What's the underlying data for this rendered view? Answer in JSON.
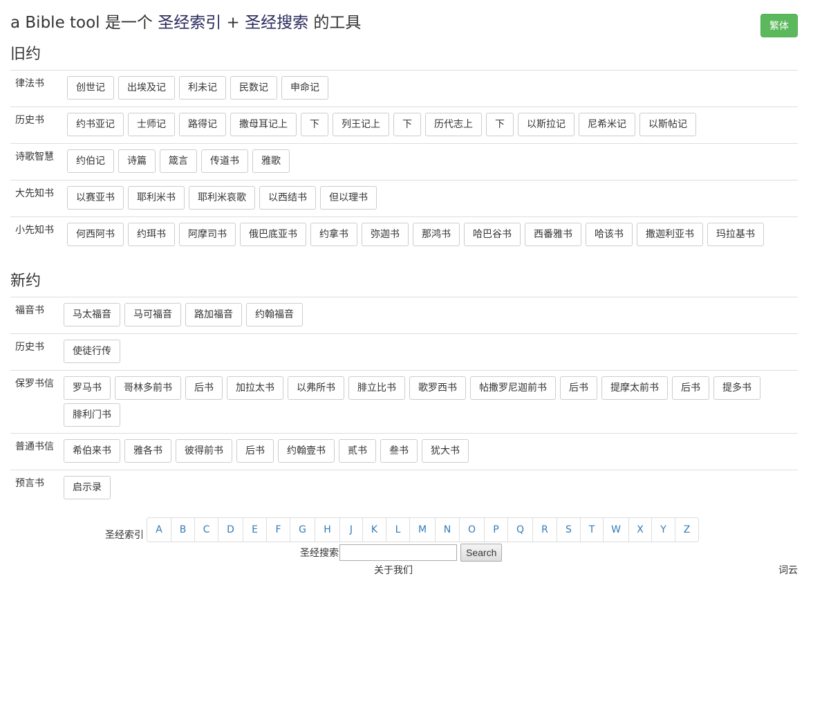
{
  "header": {
    "title_prefix": "a Bible tool",
    "title_middle1": " 是一个 ",
    "title_link1": "圣经索引",
    "title_plus": " + ",
    "title_link2": "圣经搜索",
    "title_suffix": " 的工具",
    "toggle_label": "繁体"
  },
  "old_testament": {
    "title": "旧约",
    "categories": [
      {
        "name": "律法书",
        "books": [
          "创世记",
          "出埃及记",
          "利未记",
          "民数记",
          "申命记"
        ]
      },
      {
        "name": "历史书",
        "books": [
          "约书亚记",
          "士师记",
          "路得记",
          "撒母耳记上",
          "下",
          "列王记上",
          "下",
          "历代志上",
          "下",
          "以斯拉记",
          "尼希米记",
          "以斯帖记"
        ]
      },
      {
        "name": "诗歌智慧",
        "books": [
          "约伯记",
          "诗篇",
          "箴言",
          "传道书",
          "雅歌"
        ]
      },
      {
        "name": "大先知书",
        "books": [
          "以赛亚书",
          "耶利米书",
          "耶利米哀歌",
          "以西结书",
          "但以理书"
        ]
      },
      {
        "name": "小先知书",
        "books": [
          "何西阿书",
          "约珥书",
          "阿摩司书",
          "俄巴底亚书",
          "约拿书",
          "弥迦书",
          "那鸿书",
          "哈巴谷书",
          "西番雅书",
          "哈该书",
          "撒迦利亚书",
          "玛拉基书"
        ]
      }
    ]
  },
  "new_testament": {
    "title": "新约",
    "categories": [
      {
        "name": "福音书",
        "books": [
          "马太福音",
          "马可福音",
          "路加福音",
          "约翰福音"
        ]
      },
      {
        "name": "历史书",
        "books": [
          "使徒行传"
        ]
      },
      {
        "name": "保罗书信",
        "books": [
          "罗马书",
          "哥林多前书",
          "后书",
          "加拉太书",
          "以弗所书",
          "腓立比书",
          "歌罗西书",
          "帖撒罗尼迦前书",
          "后书",
          "提摩太前书",
          "后书",
          "提多书",
          "腓利门书"
        ]
      },
      {
        "name": "普通书信",
        "books": [
          "希伯来书",
          "雅各书",
          "彼得前书",
          "后书",
          "约翰壹书",
          "贰书",
          "叁书",
          "犹大书"
        ]
      },
      {
        "name": "预言书",
        "books": [
          "启示录"
        ]
      }
    ]
  },
  "index": {
    "label": "圣经索引",
    "letters": [
      "A",
      "B",
      "C",
      "D",
      "E",
      "F",
      "G",
      "H",
      "J",
      "K",
      "L",
      "M",
      "N",
      "O",
      "P",
      "Q",
      "R",
      "S",
      "T",
      "W",
      "X",
      "Y",
      "Z"
    ]
  },
  "search": {
    "label": "圣经搜索",
    "value": "",
    "button": "Search"
  },
  "footer": {
    "about": "关于我们",
    "cloud": "词云"
  }
}
